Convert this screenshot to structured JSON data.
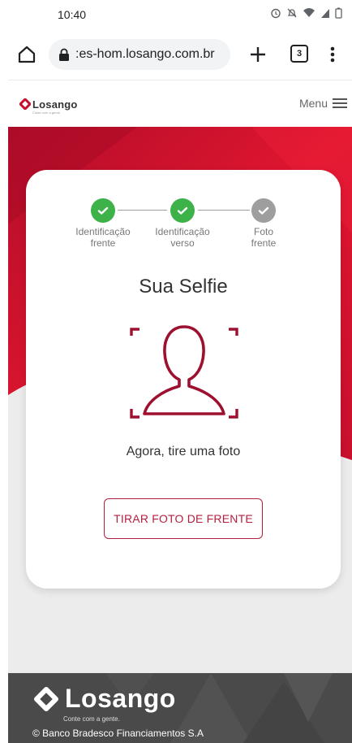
{
  "status_bar": {
    "time": "10:40"
  },
  "browser": {
    "url": ":es-hom.losango.com.br",
    "tab_count": "3"
  },
  "header": {
    "logo": "Losango",
    "logo_tagline": "Conte com a gente.",
    "menu_label": "Menu"
  },
  "steps": [
    {
      "line1": "Identificação",
      "line2": "frente",
      "status": "done"
    },
    {
      "line1": "Identificação",
      "line2": "verso",
      "status": "done"
    },
    {
      "line1": "Foto",
      "line2": "frente",
      "status": "pending"
    }
  ],
  "selfie": {
    "title": "Sua Selfie",
    "instruction": "Agora, tire uma foto",
    "button_label": "TIRAR FOTO DE FRENTE"
  },
  "footer": {
    "logo": "Losango",
    "tagline": "Conte com a gente.",
    "copyright": "© Banco Bradesco Financiamentos S.A"
  },
  "colors": {
    "brand_red": "#c8102e",
    "brand_dark_red": "#9e1030",
    "step_done": "#3db249",
    "step_pending": "#9e9e9e",
    "footer_bg": "#4a4a4a"
  },
  "icons": {
    "status": [
      "alarm-icon",
      "mute-icon",
      "wifi-icon",
      "signal-icon",
      "battery-icon"
    ],
    "browser": [
      "home-icon",
      "lock-icon",
      "plus-icon",
      "overflow-menu-icon"
    ],
    "header": [
      "hamburger-icon"
    ]
  }
}
